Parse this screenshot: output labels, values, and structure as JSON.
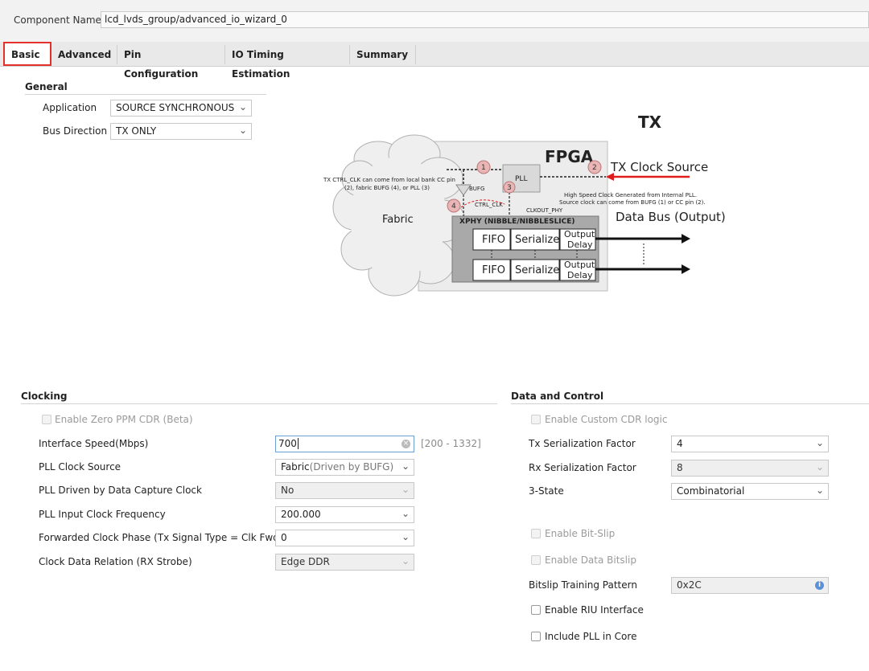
{
  "component": {
    "label": "Component Name",
    "value": "lcd_lvds_group/advanced_io_wizard_0"
  },
  "tabs": [
    "Basic",
    "Advanced",
    "Pin Configuration",
    "IO Timing Estimation",
    "Summary"
  ],
  "general": {
    "title": "General",
    "application_label": "Application",
    "application_value": "SOURCE SYNCHRONOUS",
    "bus_direction_label": "Bus Direction",
    "bus_direction_value": "TX ONLY"
  },
  "diagram": {
    "title": "TX",
    "fpga": "FPGA",
    "tx_clock_source": "TX Clock Source",
    "data_bus": "Data Bus (Output)",
    "fabric": "Fabric",
    "pll": "PLL",
    "bufg": "BUFG",
    "ctrl_clk": "CTRL_CLK",
    "clkout_phy": "CLKOUT_PHY",
    "xphy": "XPHY (NIBBLE/NIBBLESLICE)",
    "fifo": "FIFO",
    "serializer": "Serializer",
    "output": "Output",
    "delay": "Delay",
    "note_left_1": "TX CTRL_CLK  can come from local bank CC pin",
    "note_left_2": "(2), fabric BUFG (4), or PLL (3)",
    "note_right_1": "High Speed Clock Generated from Internal PLL.",
    "note_right_2": "Source clock can come from BUFG (1) or CC pin (2).",
    "n1": "1",
    "n2": "2",
    "n3": "3",
    "n4": "4"
  },
  "clocking": {
    "title": "Clocking",
    "enable_zero_ppm": "Enable Zero PPM CDR (Beta)",
    "interface_speed_label": "Interface Speed(Mbps)",
    "interface_speed_value": "700",
    "interface_speed_range": "[200 - 1332]",
    "pll_clock_source_label": "PLL Clock Source",
    "pll_clock_source_value": "Fabric",
    "pll_clock_source_hint": "(Driven by BUFG)",
    "pll_driven_label": "PLL Driven by Data Capture Clock",
    "pll_driven_value": "No",
    "pll_input_freq_label": "PLL Input Clock Frequency",
    "pll_input_freq_value": "200.000",
    "fwd_clock_phase_label": "Forwarded Clock Phase (Tx Signal Type = Clk Fwd)",
    "fwd_clock_phase_value": "0",
    "clock_data_relation_label": "Clock Data Relation (RX Strobe)",
    "clock_data_relation_value": "Edge DDR"
  },
  "data_control": {
    "title": "Data and Control",
    "enable_custom_cdr": "Enable Custom CDR logic",
    "tx_ser_label": "Tx Serialization Factor",
    "tx_ser_value": "4",
    "rx_ser_label": "Rx Serialization Factor",
    "rx_ser_value": "8",
    "three_state_label": "3-State",
    "three_state_value": "Combinatorial",
    "enable_bit_slip": "Enable Bit-Slip",
    "enable_data_bitslip": "Enable Data Bitslip",
    "bitslip_pattern_label": "Bitslip Training Pattern",
    "bitslip_pattern_value": "0x2C",
    "enable_riu": "Enable RIU Interface",
    "include_pll": "Include PLL in Core"
  },
  "colors": {
    "active_tab_border": "#e5312b",
    "accent_arrow": "#e01b1b",
    "info": "#5b8fd6"
  }
}
